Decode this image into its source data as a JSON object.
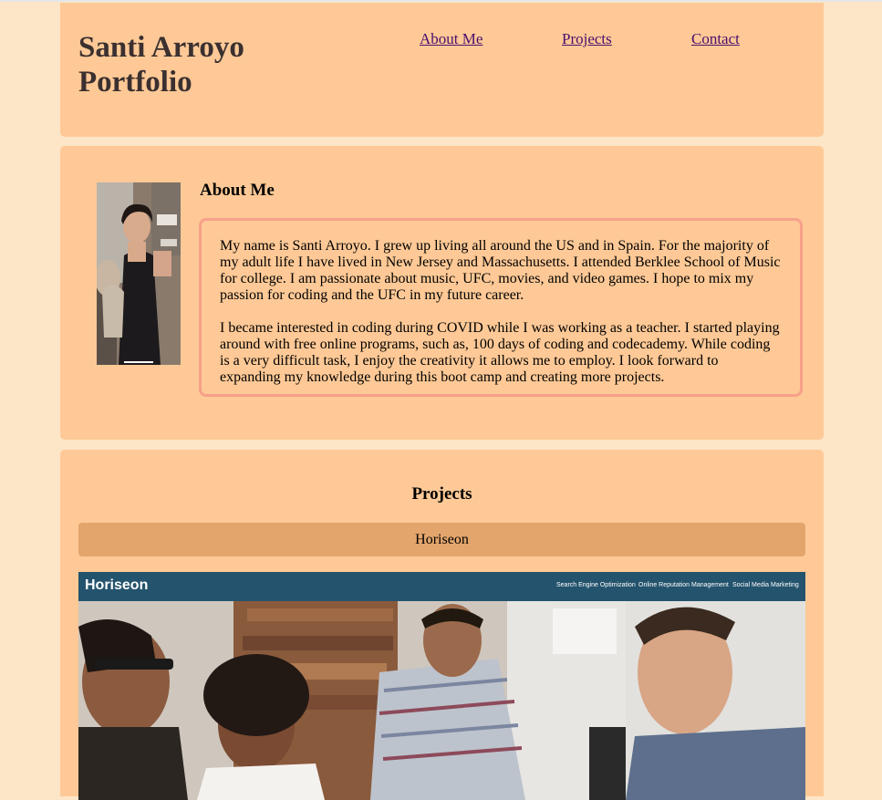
{
  "header": {
    "title_line1": "Santi Arroyo",
    "title_line2": "Portfolio",
    "nav": [
      {
        "label": "About Me"
      },
      {
        "label": "Projects"
      },
      {
        "label": "Contact"
      }
    ]
  },
  "about": {
    "heading": "About Me",
    "paragraphs": [
      "My name is Santi Arroyo. I grew up living all around the US and in Spain. For the majority of my adult life I have lived in New Jersey and Massachusetts. I attended Berklee School of Music for college. I am passionate about music, UFC, movies, and video games. I hope to mix my passion for coding and the UFC in my future career.",
      "I became interested in coding during COVID while I was working as a teacher. I started playing around with free online programs, such as, 100 days of coding and codecademy. While coding is a very difficult task, I enjoy the creativity it allows me to employ. I look forward to expanding my knowledge during this boot camp and creating more projects."
    ]
  },
  "projects": {
    "heading": "Projects",
    "items": [
      {
        "title": "Horiseon",
        "screenshot": {
          "logo": "Horiseon",
          "links": [
            "Search Engine Optimization",
            "Online Reputation Management",
            "Social Media Marketing"
          ]
        }
      }
    ]
  },
  "colors": {
    "page_bg": "#fde5c8",
    "card_bg": "#fec996",
    "bio_border": "#f7a08a",
    "project_bar": "#e3a56c",
    "link": "#4b0f6e",
    "shot_nav": "#24536d"
  }
}
